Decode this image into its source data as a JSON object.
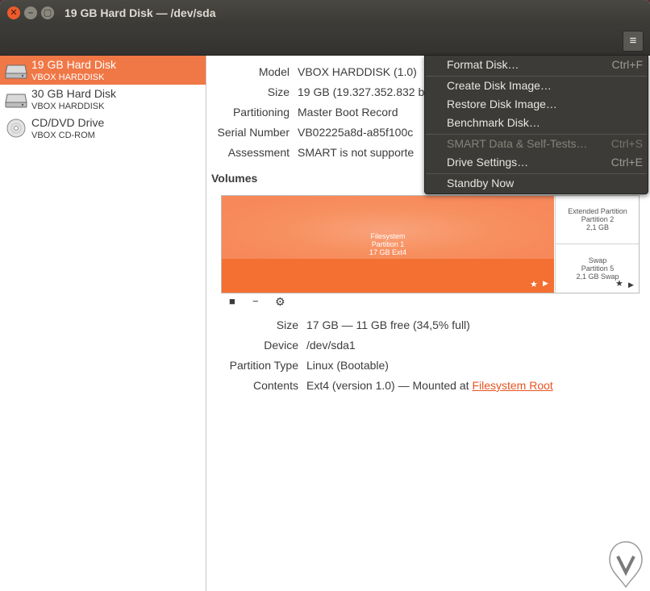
{
  "window": {
    "title": "19 GB Hard Disk — /dev/sda"
  },
  "sidebar": {
    "items": [
      {
        "name": "19 GB Hard Disk",
        "sub": "VBOX HARDDISK",
        "icon": "hard-disk-icon",
        "selected": true
      },
      {
        "name": "30 GB Hard Disk",
        "sub": "VBOX HARDDISK",
        "icon": "hard-disk-icon",
        "selected": false
      },
      {
        "name": "CD/DVD Drive",
        "sub": "VBOX CD-ROM",
        "icon": "optical-disc-icon",
        "selected": false
      }
    ]
  },
  "drive": {
    "model_label": "Model",
    "model_value": "VBOX HARDDISK (1.0)",
    "size_label": "Size",
    "size_value": "19 GB (19.327.352.832 b",
    "partitioning_label": "Partitioning",
    "partitioning_value": "Master Boot Record",
    "serial_label": "Serial Number",
    "serial_value": "VB02225a8d-a85f100c",
    "assessment_label": "Assessment",
    "assessment_value": "SMART is not supporte"
  },
  "volumes": {
    "title": "Volumes",
    "main_partition": {
      "line1": "Filesystem",
      "line2": "Partition 1",
      "line3": "17 GB Ext4"
    },
    "extended_partition": {
      "line1": "Extended Partition",
      "line2": "Partition 2",
      "line3": "2,1 GB"
    },
    "swap_partition": {
      "line1": "Swap",
      "line2": "Partition 5",
      "line3": "2,1 GB Swap"
    },
    "toolbar_icons": [
      "stop-icon",
      "minus-icon",
      "gears-icon"
    ]
  },
  "partition": {
    "size_label": "Size",
    "size_value": "17 GB — 11 GB free (34,5% full)",
    "device_label": "Device",
    "device_value": "/dev/sda1",
    "type_label": "Partition Type",
    "type_value": "Linux (Bootable)",
    "contents_label": "Contents",
    "contents_value": "Ext4 (version 1.0) — Mounted at ",
    "contents_link": "Filesystem Root"
  },
  "menu": {
    "items": [
      {
        "label": "Format Disk…",
        "accel": "Ctrl+F",
        "enabled": true
      },
      {
        "label": "Create Disk Image…",
        "accel": "",
        "enabled": true
      },
      {
        "label": "Restore Disk Image…",
        "accel": "",
        "enabled": true
      },
      {
        "label": "Benchmark Disk…",
        "accel": "",
        "enabled": true
      },
      {
        "label": "SMART Data & Self-Tests…",
        "accel": "Ctrl+S",
        "enabled": false
      },
      {
        "label": "Drive Settings…",
        "accel": "Ctrl+E",
        "enabled": true
      },
      {
        "label": "Standby Now",
        "accel": "",
        "enabled": true
      }
    ]
  },
  "colors": {
    "accent": "#f07746",
    "partition_fill": "#f7885a",
    "menu_bg": "#3c3b37"
  }
}
